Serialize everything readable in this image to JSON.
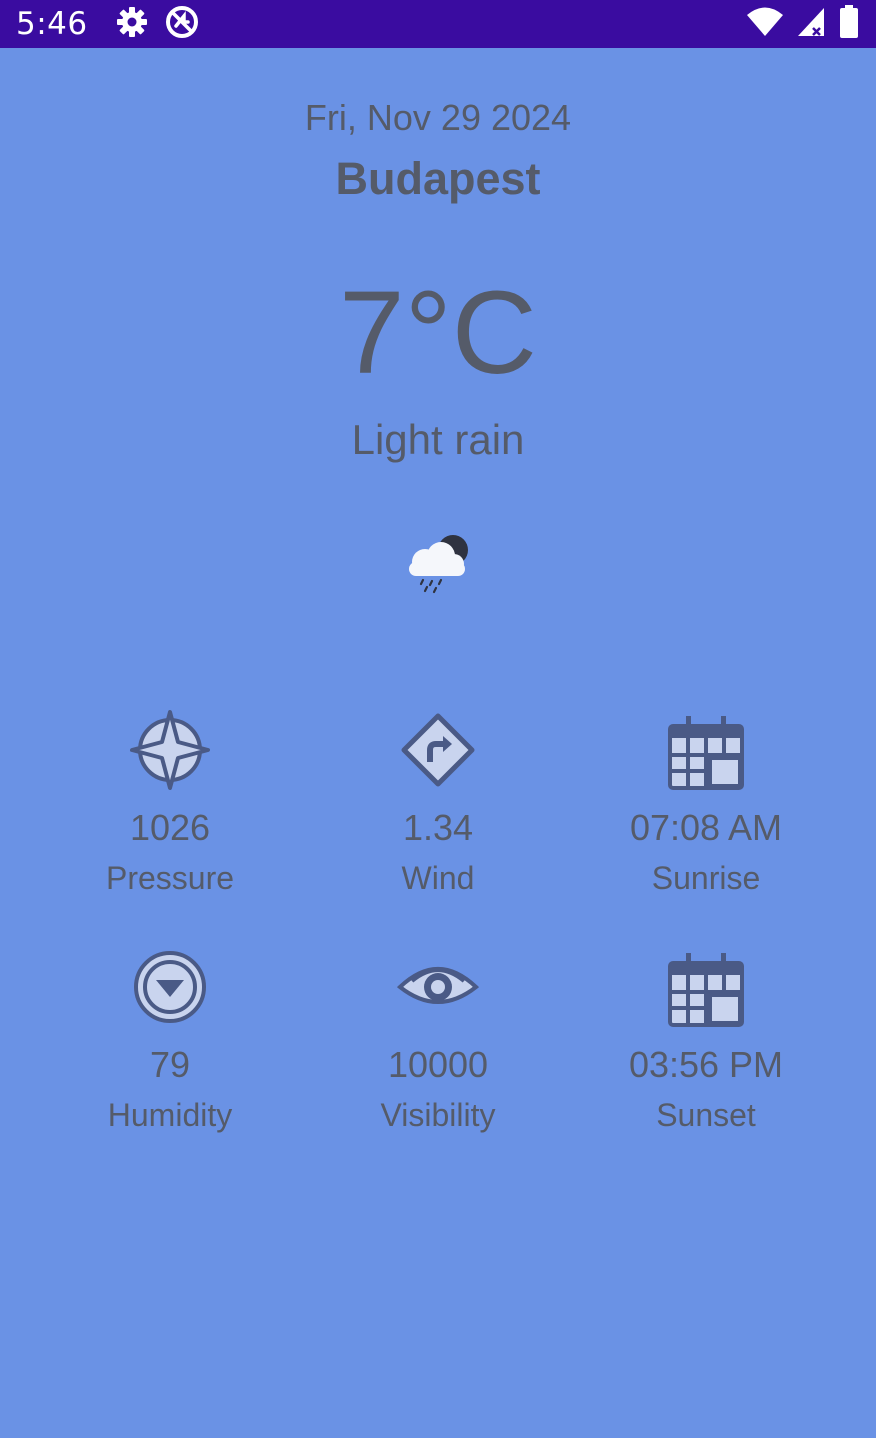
{
  "status_bar": {
    "time": "5:46",
    "background": "#3a0ca0",
    "icons": [
      "settings-icon",
      "do-not-disturb-icon",
      "wifi-icon",
      "signal-icon",
      "battery-icon"
    ]
  },
  "header": {
    "date": "Fri, Nov 29 2024",
    "city": "Budapest"
  },
  "current": {
    "temperature": "7°C",
    "description": "Light rain",
    "icon": "light-rain-cloud-icon"
  },
  "details": [
    {
      "value": "1026",
      "label": "Pressure",
      "icon": "compass-icon"
    },
    {
      "value": "1.34",
      "label": "Wind",
      "icon": "direction-sign-icon"
    },
    {
      "value": "07:08 AM",
      "label": "Sunrise",
      "icon": "calendar-icon"
    },
    {
      "value": "79",
      "label": "Humidity",
      "icon": "circle-down-arrow-icon"
    },
    {
      "value": "10000",
      "label": "Visibility",
      "icon": "eye-icon"
    },
    {
      "value": "03:56 PM",
      "label": "Sunset",
      "icon": "calendar-icon"
    }
  ],
  "colors": {
    "background": "#6a92e5",
    "text": "#555b69",
    "icon_fill": "#c9d4ee",
    "icon_stroke": "#4a5a86"
  }
}
